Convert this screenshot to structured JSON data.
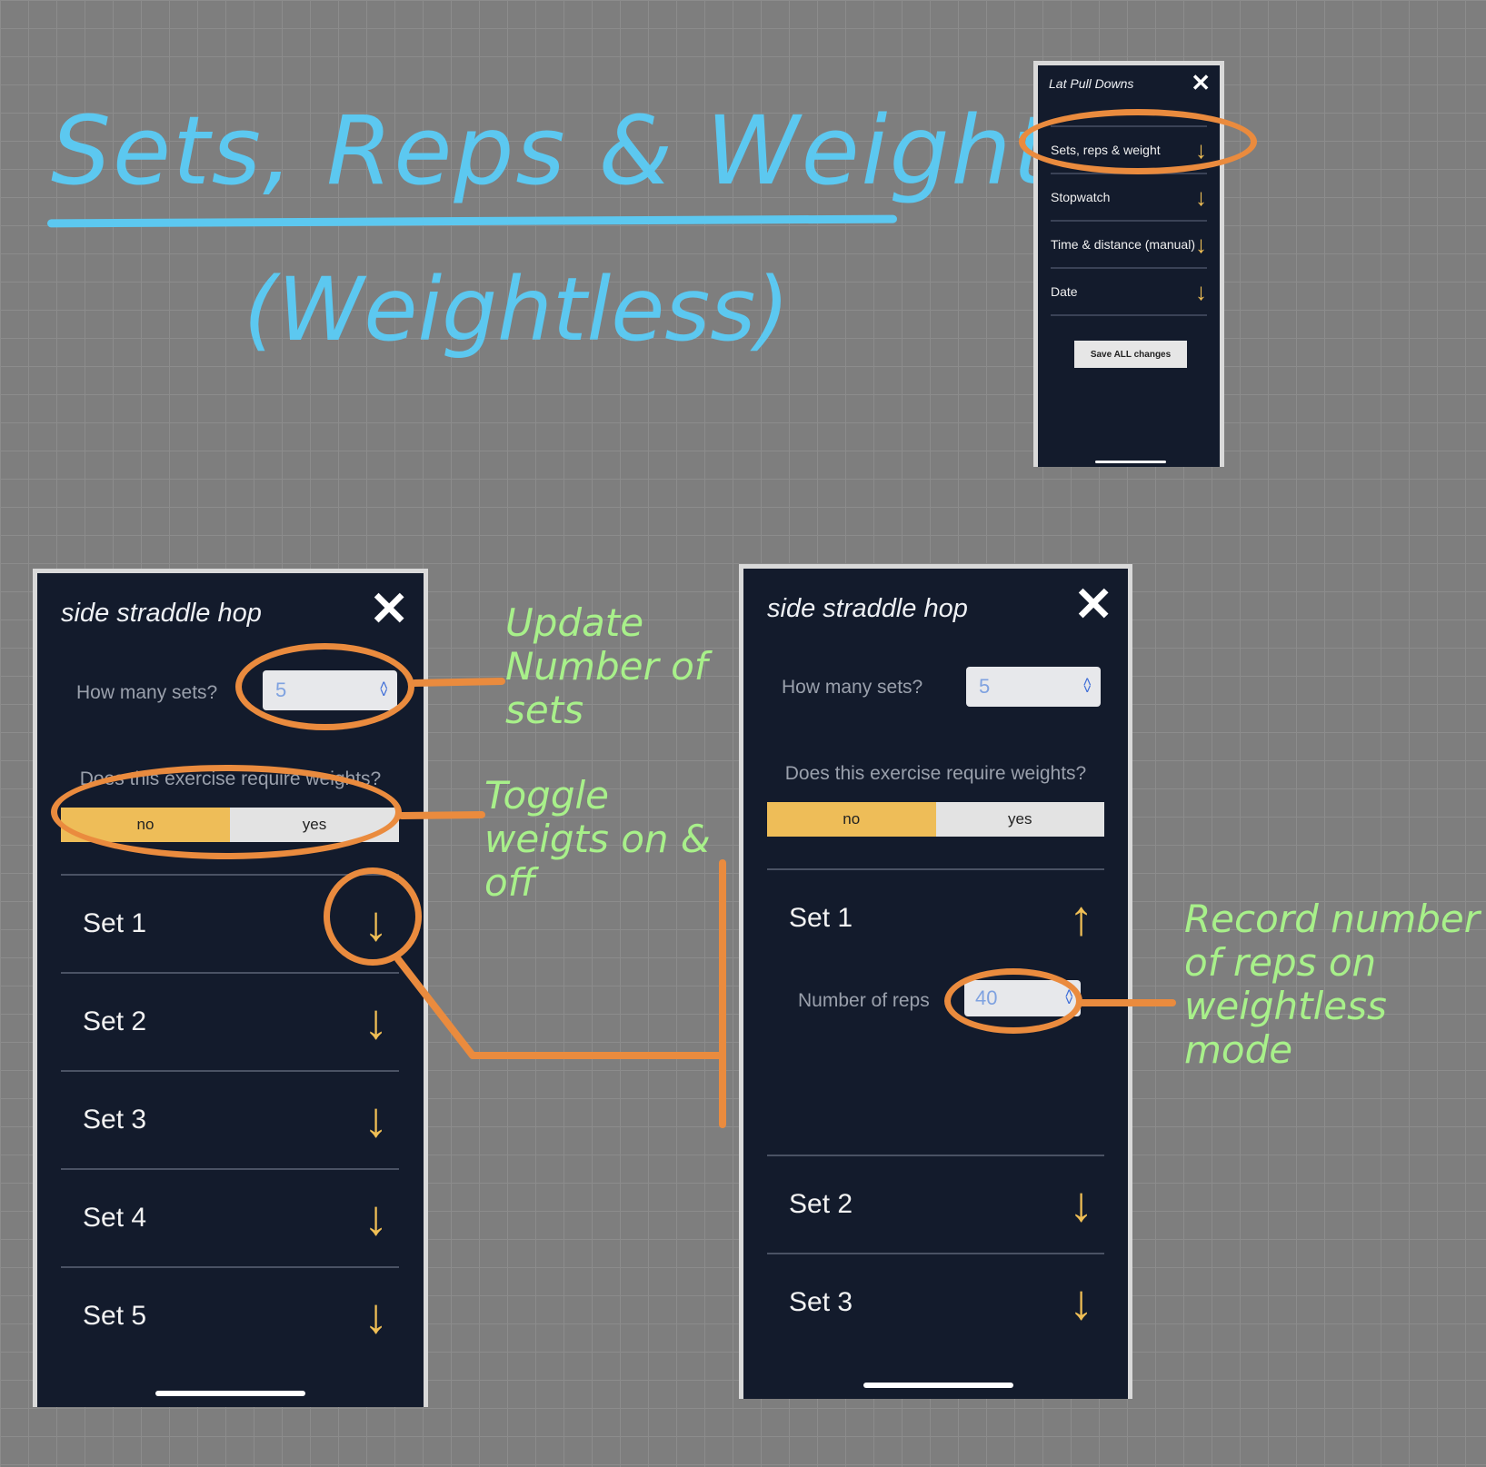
{
  "heading": {
    "title": "Sets, Reps & Weight",
    "subtitle": "(Weightless)"
  },
  "notes": {
    "update_sets": "Update Number of sets",
    "toggle_weights": "Toggle weigts on & off",
    "record_reps": "Record number of reps on weightless mode"
  },
  "mini_phone": {
    "title": "Lat Pull Downs",
    "close": "✕",
    "rows": [
      {
        "label": "Sets, reps & weight",
        "icon": "arrow-down-icon"
      },
      {
        "label": "Stopwatch",
        "icon": "arrow-down-icon"
      },
      {
        "label": "Time & distance (manual)",
        "icon": "arrow-down-icon"
      },
      {
        "label": "Date",
        "icon": "arrow-down-icon"
      }
    ],
    "save_label": "Save ALL changes"
  },
  "phone_left": {
    "title": "side straddle hop",
    "close": "✕",
    "sets_label": "How many sets?",
    "sets_value": "5",
    "weights_question": "Does this exercise require weights?",
    "toggle": {
      "no": "no",
      "yes": "yes",
      "selected": "no"
    },
    "sets": [
      {
        "label": "Set 1",
        "arrow": "↓"
      },
      {
        "label": "Set 2",
        "arrow": "↓"
      },
      {
        "label": "Set 3",
        "arrow": "↓"
      },
      {
        "label": "Set 4",
        "arrow": "↓"
      },
      {
        "label": "Set 5",
        "arrow": "↓"
      }
    ]
  },
  "phone_right": {
    "title": "side straddle hop",
    "close": "✕",
    "sets_label": "How many sets?",
    "sets_value": "5",
    "weights_question": "Does this exercise require weights?",
    "toggle": {
      "no": "no",
      "yes": "yes",
      "selected": "no"
    },
    "sets": [
      {
        "label": "Set 1",
        "arrow": "↑",
        "expanded": true
      },
      {
        "label": "Set 2",
        "arrow": "↓"
      },
      {
        "label": "Set 3",
        "arrow": "↓"
      }
    ],
    "reps_label": "Number of reps",
    "reps_value": "40"
  },
  "colors": {
    "background": "#7e7e7e",
    "phone_bg": "#131b2c",
    "accent_yellow": "#eebd58",
    "annotation_orange": "#ea8b3e",
    "title_blue": "#5cc8f0",
    "note_green": "#a8f08a"
  }
}
